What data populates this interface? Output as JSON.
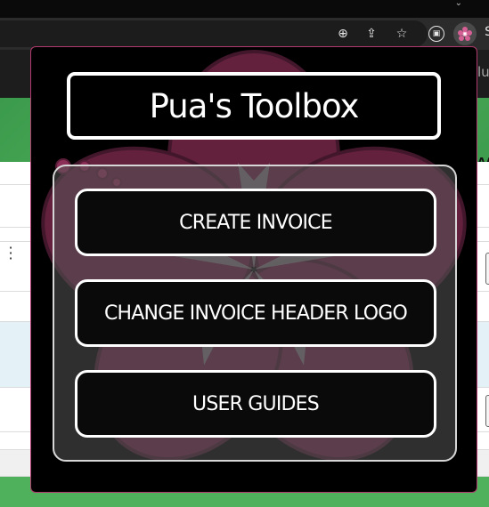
{
  "browser": {
    "toolbar_icons": [
      "zoom-icon",
      "share-icon",
      "star-icon",
      "extension-icon",
      "hibiscus-extension-icon"
    ],
    "cutoff_text": "S",
    "colors": {
      "toolbar": "#2b2b2b",
      "omnibox": "#1c1c1c"
    }
  },
  "page": {
    "partial_text_right": "lu",
    "partial_label_right": "AA",
    "colors": {
      "green": "#4fb15b",
      "row_highlight": "#e4f1f6"
    }
  },
  "popup": {
    "title": "Pua's Toolbox",
    "buttons": [
      {
        "label": "CREATE INVOICE"
      },
      {
        "label": "CHANGE INVOICE HEADER LOGO"
      },
      {
        "label": "USER GUIDES"
      }
    ],
    "colors": {
      "background": "#000000",
      "border": "#b03a6e",
      "flower": "#7a2a4c",
      "panel": "#555555"
    }
  }
}
